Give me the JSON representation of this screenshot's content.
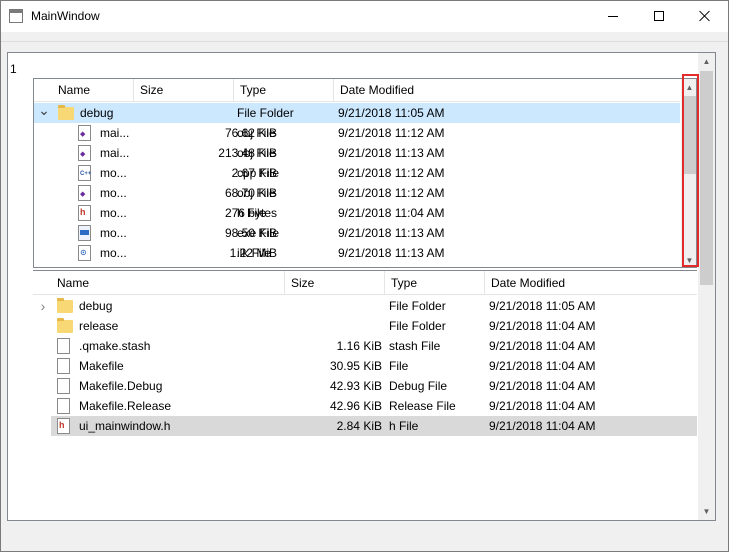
{
  "window": {
    "title": "MainWindow"
  },
  "panel": {
    "label": "1"
  },
  "tree": {
    "columns": [
      "Name",
      "Size",
      "Type",
      "Date Modified"
    ],
    "rows": [
      {
        "name": "debug",
        "size": "",
        "type": "File Folder",
        "date": "9/21/2018 11:05 AM",
        "icon": "folder-icon",
        "expanded": true,
        "selected": true
      },
      {
        "name": "mai...",
        "size": "76.62 KiB",
        "type": "obj File",
        "date": "9/21/2018 11:12 AM",
        "icon": "obj-file-icon"
      },
      {
        "name": "mai...",
        "size": "213.48 KiB",
        "type": "obj File",
        "date": "9/21/2018 11:13 AM",
        "icon": "obj-file-icon"
      },
      {
        "name": "mo...",
        "size": "2.67 KiB",
        "type": "cpp File",
        "date": "9/21/2018 11:12 AM",
        "icon": "cpp-file-icon"
      },
      {
        "name": "mo...",
        "size": "68.70 KiB",
        "type": "obj File",
        "date": "9/21/2018 11:12 AM",
        "icon": "obj-file-icon"
      },
      {
        "name": "mo...",
        "size": "276 bytes",
        "type": "h File",
        "date": "9/21/2018 11:04 AM",
        "icon": "h-file-icon"
      },
      {
        "name": "mo...",
        "size": "98.50 KiB",
        "type": "exe File",
        "date": "9/21/2018 11:13 AM",
        "icon": "exe-file-icon"
      },
      {
        "name": "mo...",
        "size": "1.22 MiB",
        "type": "ilk File",
        "date": "9/21/2018 11:13 AM",
        "icon": "ilk-file-icon"
      }
    ]
  },
  "list": {
    "columns": [
      "Name",
      "Size",
      "Type",
      "Date Modified"
    ],
    "rows": [
      {
        "name": "debug",
        "size": "",
        "type": "File Folder",
        "date": "9/21/2018 11:05 AM",
        "icon": "folder-icon",
        "expandable": true
      },
      {
        "name": "release",
        "size": "",
        "type": "File Folder",
        "date": "9/21/2018 11:04 AM",
        "icon": "folder-icon"
      },
      {
        "name": ".qmake.stash",
        "size": "1.16 KiB",
        "type": "stash File",
        "date": "9/21/2018 11:04 AM",
        "icon": "file-icon"
      },
      {
        "name": "Makefile",
        "size": "30.95 KiB",
        "type": "File",
        "date": "9/21/2018 11:04 AM",
        "icon": "file-icon"
      },
      {
        "name": "Makefile.Debug",
        "size": "42.93 KiB",
        "type": "Debug File",
        "date": "9/21/2018 11:04 AM",
        "icon": "file-icon"
      },
      {
        "name": "Makefile.Release",
        "size": "42.96 KiB",
        "type": "Release File",
        "date": "9/21/2018 11:04 AM",
        "icon": "file-icon"
      },
      {
        "name": "ui_mainwindow.h",
        "size": "2.84 KiB",
        "type": "h File",
        "date": "9/21/2018 11:04 AM",
        "icon": "h-file-icon",
        "selected": true
      }
    ]
  }
}
